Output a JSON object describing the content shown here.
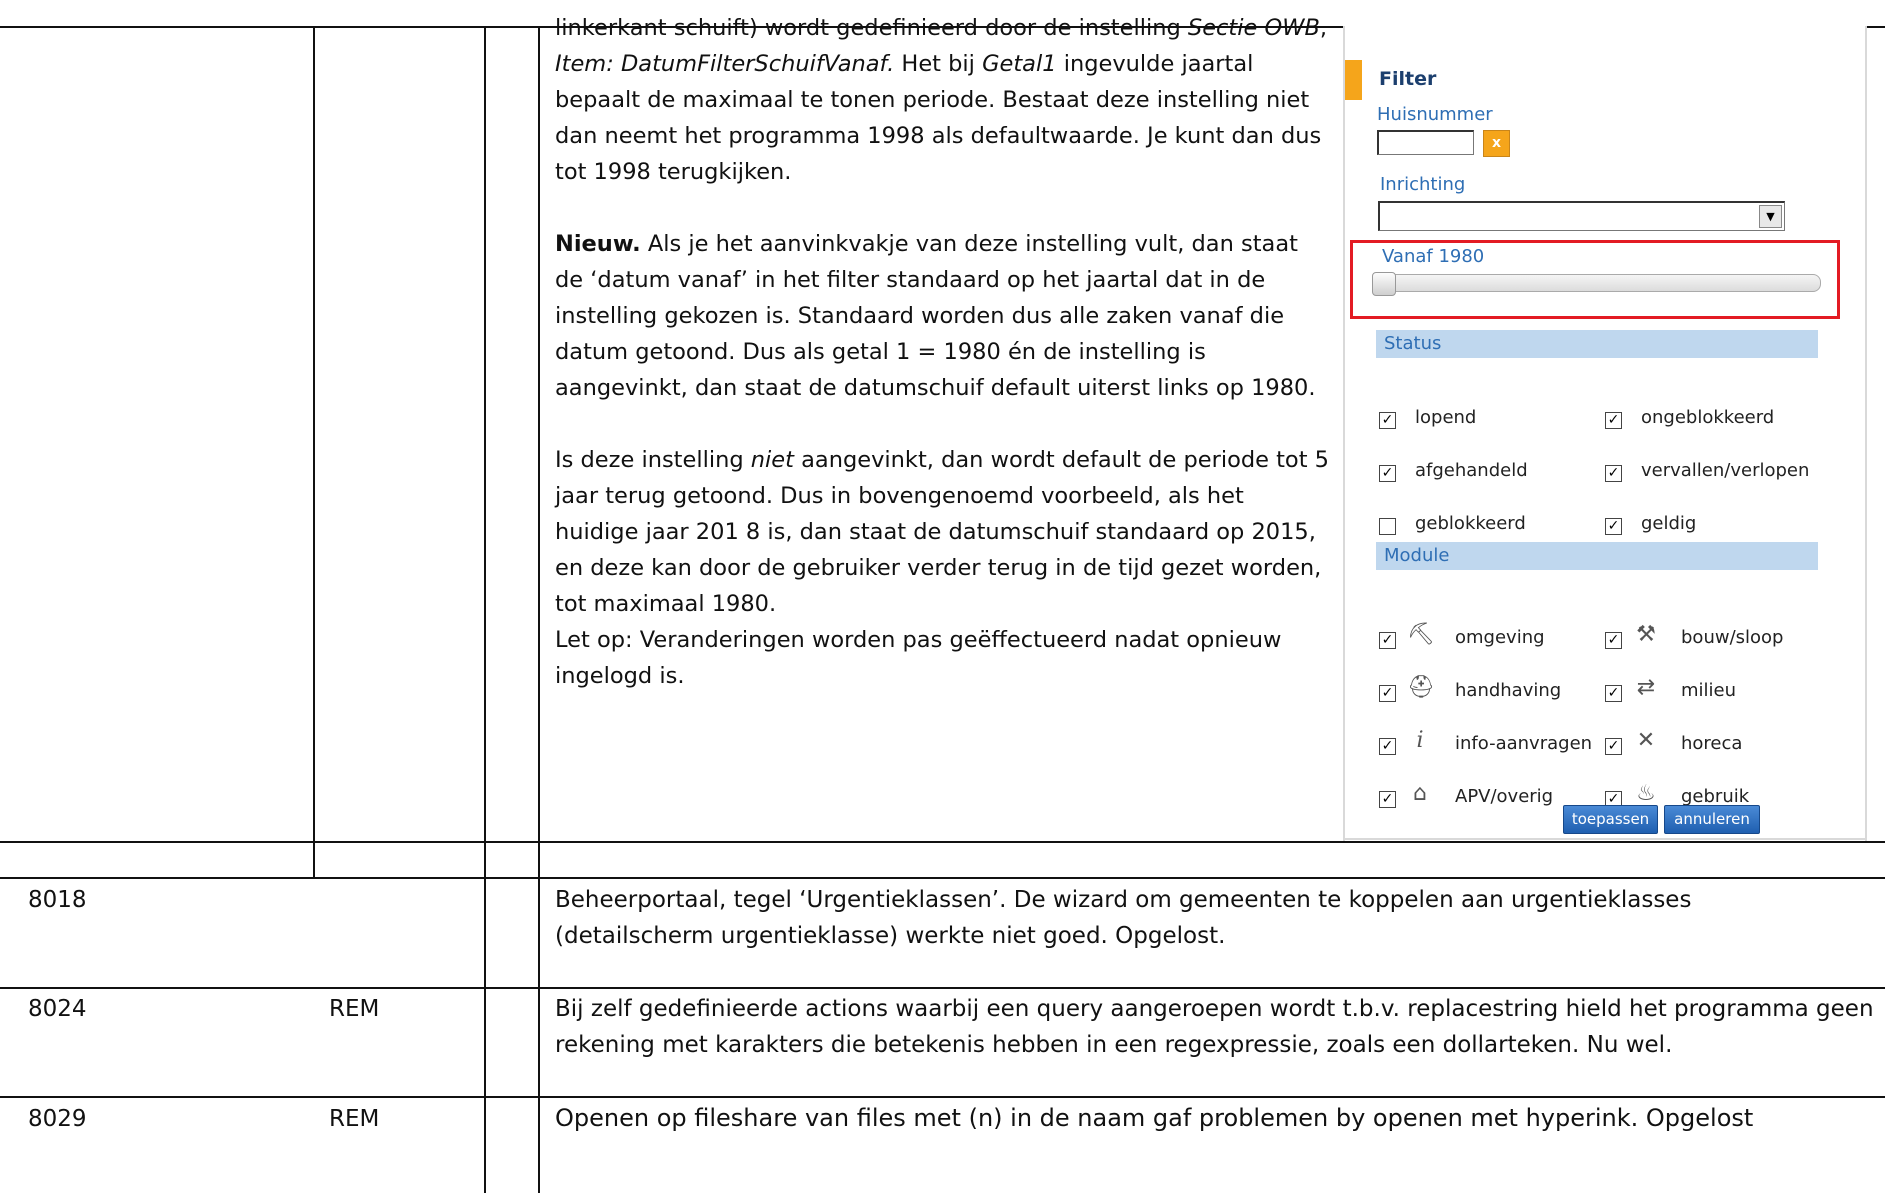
{
  "top_text": {
    "p1_a": "linkerkant schuift) wordt gedefinieerd door de instelling ",
    "p1_sectie": "Sectie OWB",
    "p1_comma": ", ",
    "p1_item": "Item: DatumFilterSchuifVanaf.",
    "p1_b": " Het bij ",
    "p1_getal1": "Getal1",
    "p1_c": " ingevulde jaartal bepaalt de maximaal te tonen periode.  Bestaat deze instelling niet dan neemt het programma 1998 als defaultwaarde. Je kunt dan dus tot 1998 terugkijken.",
    "p2_bold": "Nieuw.",
    "p2_rest": "  Als je het aanvinkvakje van deze  instelling vult, dan staat de ‘datum vanaf’ in het filter standaard op het jaartal dat in de instelling gekozen is. Standaard worden dus alle zaken vanaf die datum getoond. Dus als getal 1 = 1980 én de instelling is aangevinkt, dan staat de datumschuif default uiterst links op 1980.",
    "p3_a": "Is deze instelling ",
    "p3_niet": "niet",
    "p3_b": " aangevinkt, dan wordt default de periode tot 5 jaar terug getoond. Dus in bovengenoemd voorbeeld, als het huidige jaar 201 8 is, dan  staat de datumschuif standaard op 2015, en deze kan door de gebruiker verder terug in de tijd gezet worden, tot maximaal 1980.",
    "p4": "Let op: Veranderingen worden pas geëffectueerd nadat opnieuw ingelogd is."
  },
  "filter_panel": {
    "title": "Filter",
    "huisnummer_label": "Huisnummer",
    "huisnummer_value": "",
    "clear_label": "x",
    "inrichting_label": "Inrichting",
    "inrichting_value": "",
    "vanaf_label": "Vanaf 1980",
    "slider_position": 0,
    "status_header": "Status",
    "status_items": [
      {
        "label": "lopend",
        "checked": true
      },
      {
        "label": "ongeblokkeerd",
        "checked": true
      },
      {
        "label": "afgehandeld",
        "checked": true
      },
      {
        "label": "vervallen/verlopen",
        "checked": true
      },
      {
        "label": "geblokkeerd",
        "checked": false
      },
      {
        "label": "geldig",
        "checked": true
      }
    ],
    "module_header": "Module",
    "module_items": [
      {
        "label": "omgeving",
        "icon": "worker-icon",
        "checked": true
      },
      {
        "label": "bouw/sloop",
        "icon": "tools-icon",
        "checked": true
      },
      {
        "label": "handhaving",
        "icon": "inspector-icon",
        "checked": true
      },
      {
        "label": "milieu",
        "icon": "recycle-icon",
        "checked": true
      },
      {
        "label": "info-aanvragen",
        "icon": "info-icon",
        "checked": true
      },
      {
        "label": "horeca",
        "icon": "cutlery-icon",
        "checked": true
      },
      {
        "label": "APV/overig",
        "icon": "market-stall-icon",
        "checked": true
      },
      {
        "label": "gebruik",
        "icon": "fire-icon",
        "checked": true
      }
    ],
    "apply_button": "toepassen",
    "cancel_button": "annuleren",
    "check_glyph": "☑",
    "uncheck_glyph": ""
  },
  "rows": [
    {
      "id": "8018",
      "code": "",
      "text": "Beheerportaal, tegel ‘Urgentieklassen’. De wizard om gemeenten te koppelen aan urgentieklasses (detailscherm urgentieklasse) werkte niet goed. Opgelost."
    },
    {
      "id": "8024",
      "code": "REM",
      "text": "Bij zelf gedefinieerde actions waarbij een query aangeroepen wordt t.b.v. replacestring hield het programma geen rekening met karakters die betekenis hebben in een regexpressie, zoals een dollarteken. Nu wel."
    },
    {
      "id": "8029",
      "code": "REM",
      "text": "Openen op fileshare van files met (n) in de naam gaf problemen by openen met hyperink. Opgelost"
    }
  ],
  "colors": {
    "border": "#111111",
    "accent": "#f5a51b",
    "panel_blue": "#2e6eb4",
    "section_bg": "#bfd7ee",
    "highlight_red": "#e31b23"
  }
}
